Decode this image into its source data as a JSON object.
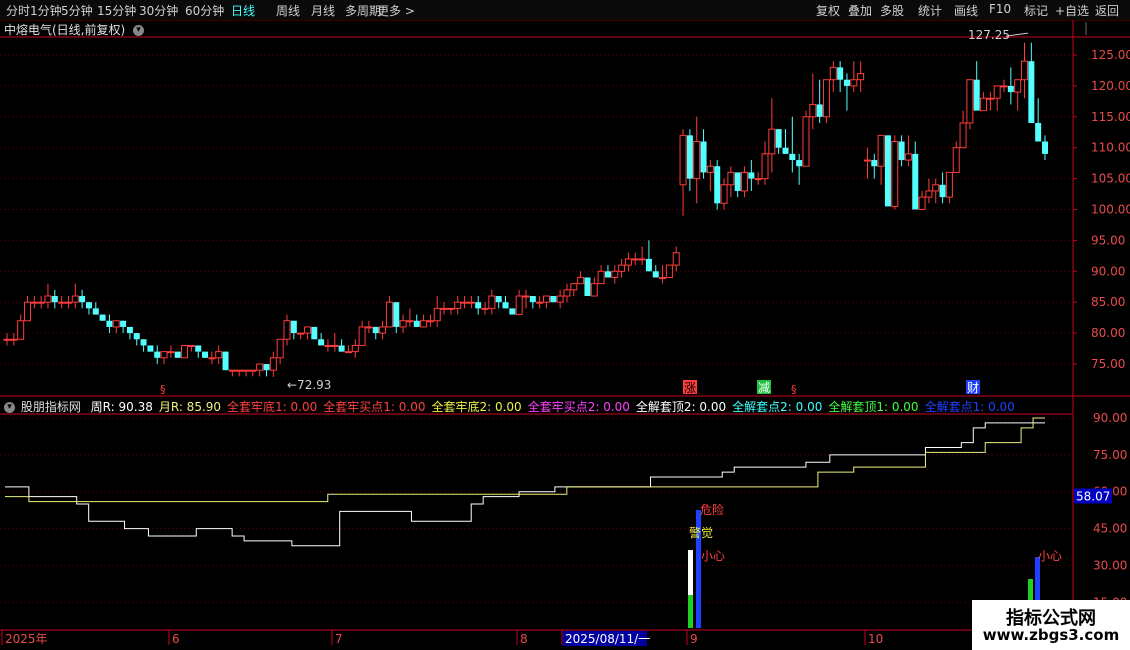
{
  "toolbar": {
    "periods": [
      "分时",
      "1分钟",
      "5分钟",
      "15分钟",
      "30分钟",
      "60分钟",
      "日线",
      "周线",
      "月线",
      "多周期",
      "更多 >"
    ],
    "active_period": "日线",
    "actions": [
      "复权",
      "叠加",
      "多股",
      "统计",
      "画线",
      "F10",
      "标记",
      "+自选",
      "返回"
    ]
  },
  "stock": {
    "title": "中熔电气(日线,前复权)"
  },
  "colors": {
    "up": "#ff3b3b",
    "down": "#54ffff",
    "grid": "#6b0000",
    "axis": "#c8001e",
    "text_axis": "#e84b4b",
    "yellow": "#f0f080",
    "white": "#ffffff"
  },
  "chart_data": {
    "type": "candlestick",
    "annotations": {
      "high_label": "127.25",
      "low_label": "72.93"
    },
    "price_ticks": [
      "125.00",
      "120.00",
      "115.00",
      "110.00",
      "105.00",
      "100.00",
      "95.00",
      "90.00",
      "85.00",
      "80.00",
      "75.00"
    ],
    "x_labels": [
      "2025年",
      "6",
      "7",
      "8",
      "2025/08/11/一",
      "9",
      "10"
    ],
    "candles": [
      [
        79,
        80,
        78,
        79
      ],
      [
        79,
        80,
        78,
        79
      ],
      [
        79,
        83,
        79,
        82
      ],
      [
        82,
        86,
        82,
        85
      ],
      [
        85,
        86,
        84,
        85
      ],
      [
        85,
        86,
        84,
        85
      ],
      [
        85,
        88,
        84,
        86
      ],
      [
        86,
        87,
        84,
        85
      ],
      [
        85,
        86,
        84,
        85
      ],
      [
        85,
        86,
        84,
        85
      ],
      [
        85,
        88,
        84,
        86
      ],
      [
        86,
        87,
        84,
        85
      ],
      [
        85,
        85,
        83,
        84
      ],
      [
        84,
        85,
        83,
        83
      ],
      [
        83,
        83,
        82,
        82
      ],
      [
        82,
        83,
        80,
        81
      ],
      [
        81,
        82,
        80,
        82
      ],
      [
        82,
        82,
        80,
        81
      ],
      [
        81,
        81,
        79,
        80
      ],
      [
        80,
        80,
        78,
        79
      ],
      [
        79,
        79,
        77,
        78
      ],
      [
        78,
        78,
        77,
        77
      ],
      [
        77,
        78,
        75,
        76
      ],
      [
        76,
        77,
        75,
        77
      ],
      [
        77,
        78,
        76,
        77
      ],
      [
        77,
        77,
        76,
        76
      ],
      [
        76,
        78,
        76,
        78
      ],
      [
        78,
        78,
        77,
        78
      ],
      [
        78,
        78,
        76,
        77
      ],
      [
        77,
        77,
        76,
        76
      ],
      [
        76,
        77,
        75,
        76
      ],
      [
        76,
        78,
        75,
        77
      ],
      [
        77,
        77,
        74,
        74
      ],
      [
        74,
        74,
        73,
        74
      ],
      [
        74,
        74,
        73,
        74
      ],
      [
        74,
        74,
        73,
        74
      ],
      [
        74,
        74,
        73,
        74
      ],
      [
        74,
        75,
        73,
        75
      ],
      [
        75,
        75,
        73,
        74
      ],
      [
        74,
        77,
        72.9,
        76
      ],
      [
        76,
        79,
        75,
        79
      ],
      [
        79,
        83,
        78,
        82
      ],
      [
        82,
        82,
        79,
        80
      ],
      [
        80,
        80,
        79,
        80
      ],
      [
        80,
        81,
        79,
        81
      ],
      [
        81,
        81,
        79,
        79
      ],
      [
        79,
        80,
        78,
        78
      ],
      [
        78,
        79,
        77,
        78
      ],
      [
        78,
        80,
        77,
        78
      ],
      [
        78,
        79,
        77,
        77
      ],
      [
        77,
        78,
        77,
        77
      ],
      [
        77,
        79,
        76,
        78
      ],
      [
        78,
        82,
        78,
        81
      ],
      [
        81,
        82,
        80,
        81
      ],
      [
        81,
        81,
        79,
        80
      ],
      [
        80,
        82,
        79,
        81
      ],
      [
        81,
        86,
        81,
        85
      ],
      [
        85,
        85,
        80,
        81
      ],
      [
        81,
        83,
        80,
        82
      ],
      [
        82,
        84,
        81,
        82
      ],
      [
        82,
        83,
        81,
        81
      ],
      [
        81,
        83,
        81,
        82
      ],
      [
        82,
        83,
        81,
        82
      ],
      [
        82,
        86,
        81,
        84
      ],
      [
        84,
        85,
        83,
        84
      ],
      [
        84,
        84,
        83,
        84
      ],
      [
        84,
        86,
        83,
        85
      ],
      [
        85,
        86,
        84,
        85
      ],
      [
        85,
        86,
        84,
        85
      ],
      [
        85,
        86,
        83,
        84
      ],
      [
        84,
        85,
        83,
        84
      ],
      [
        84,
        87,
        83,
        86
      ],
      [
        86,
        86,
        84,
        85
      ],
      [
        85,
        86,
        84,
        84
      ],
      [
        84,
        84,
        83,
        83
      ],
      [
        83,
        87,
        83,
        86
      ],
      [
        86,
        87,
        84,
        86
      ],
      [
        86,
        86,
        84,
        85
      ],
      [
        85,
        86,
        84,
        85
      ],
      [
        85,
        86,
        84,
        86
      ],
      [
        86,
        86,
        85,
        85
      ],
      [
        85,
        87,
        84,
        86
      ],
      [
        86,
        88,
        85,
        87
      ],
      [
        87,
        88,
        86,
        88
      ],
      [
        88,
        90,
        88,
        89
      ],
      [
        89,
        89,
        86,
        86
      ],
      [
        86,
        89,
        86,
        88
      ],
      [
        88,
        91,
        88,
        90
      ],
      [
        90,
        91,
        89,
        89
      ],
      [
        89,
        91,
        88,
        90
      ],
      [
        90,
        92,
        89,
        91
      ],
      [
        91,
        93,
        90,
        92
      ],
      [
        92,
        93,
        91,
        92
      ],
      [
        92,
        94,
        91,
        92
      ],
      [
        92,
        95,
        90,
        90
      ],
      [
        90,
        91,
        89,
        89
      ],
      [
        89,
        91,
        88,
        89
      ],
      [
        89,
        91,
        89,
        91
      ],
      [
        91,
        94,
        90,
        93
      ],
      [
        104,
        113,
        99,
        112
      ],
      [
        112,
        113,
        103,
        105
      ],
      [
        105,
        115,
        101,
        111
      ],
      [
        111,
        113,
        105,
        106
      ],
      [
        106,
        108,
        103,
        107
      ],
      [
        107,
        108,
        100,
        101
      ],
      [
        101,
        105,
        100,
        104
      ],
      [
        104,
        107,
        102,
        106
      ],
      [
        106,
        106,
        102,
        103
      ],
      [
        103,
        107,
        102,
        106
      ],
      [
        106,
        108,
        103,
        105
      ],
      [
        105,
        106,
        104,
        105
      ],
      [
        105,
        111,
        104,
        109
      ],
      [
        109,
        118,
        106,
        113
      ],
      [
        113,
        113,
        109,
        110
      ],
      [
        110,
        113,
        109,
        109
      ],
      [
        109,
        115,
        106,
        108
      ],
      [
        108,
        109,
        104,
        107
      ],
      [
        107,
        116,
        107,
        115
      ],
      [
        115,
        122,
        113,
        117
      ],
      [
        117,
        121,
        114,
        115
      ],
      [
        115,
        121,
        114,
        121
      ],
      [
        121,
        124,
        119,
        123
      ],
      [
        123,
        124,
        119,
        121
      ],
      [
        121,
        122,
        116,
        120
      ],
      [
        120,
        124,
        119,
        121
      ],
      [
        121,
        124,
        119,
        122
      ],
      [
        108,
        110,
        105,
        108
      ],
      [
        108,
        109,
        105,
        107
      ],
      [
        107,
        112,
        104,
        112
      ],
      [
        112,
        112,
        101,
        100.5
      ],
      [
        100.5,
        112,
        100,
        111
      ],
      [
        111,
        112,
        107,
        108
      ],
      [
        108,
        112,
        107,
        109
      ],
      [
        109,
        111,
        101,
        100
      ],
      [
        100,
        103,
        100,
        102
      ],
      [
        102,
        105,
        101,
        103
      ],
      [
        103,
        105,
        101,
        104
      ],
      [
        104,
        106,
        101,
        102
      ],
      [
        102,
        106,
        101,
        106
      ],
      [
        106,
        111,
        106,
        110
      ],
      [
        110,
        116,
        110,
        114
      ],
      [
        114,
        120,
        113,
        121
      ],
      [
        121,
        124,
        119,
        116
      ],
      [
        116,
        119,
        116,
        118
      ],
      [
        118,
        119,
        116,
        118
      ],
      [
        118,
        120,
        116,
        120
      ],
      [
        120,
        121,
        119,
        120
      ],
      [
        120,
        123,
        117,
        119
      ],
      [
        119,
        121,
        116,
        121
      ],
      [
        121,
        127,
        118,
        124
      ],
      [
        124,
        127,
        115,
        114
      ],
      [
        114,
        118,
        112,
        111
      ],
      [
        111,
        112,
        108,
        109
      ]
    ],
    "event_markers": [
      "涨",
      "减",
      "财"
    ],
    "indicator": {
      "name": "股朋指标网",
      "legend": [
        {
          "label": "周R: 90.38",
          "color": "#ffffff"
        },
        {
          "label": "月R: 85.90",
          "color": "#f0f080"
        },
        {
          "label": "全套牢底1: 0.00",
          "color": "#ff4040"
        },
        {
          "label": "全套牢买点1: 0.00",
          "color": "#ff4040"
        },
        {
          "label": "全套牢底2: 0.00",
          "color": "#f0f040"
        },
        {
          "label": "全套牢买点2: 0.00",
          "color": "#ff40ff"
        },
        {
          "label": "全解套顶2: 0.00",
          "color": "#ffffff"
        },
        {
          "label": "全解套点2: 0.00",
          "color": "#40ffff"
        },
        {
          "label": "全解套顶1: 0.00",
          "color": "#40ff40"
        },
        {
          "label": "全解套点1: 0.00",
          "color": "#2040ff"
        }
      ],
      "ticks": [
        "90.00",
        "75.00",
        "60.00",
        "45.00",
        "30.00",
        "15.00"
      ],
      "current_value": "58.07",
      "signals": [
        {
          "label": "危险",
          "color": "#ff4040"
        },
        {
          "label": "警觉",
          "color": "#f0f040"
        },
        {
          "label": "小心",
          "color": "#ff4040"
        },
        {
          "label": "小心",
          "color": "#ff4040"
        }
      ],
      "white_line": [
        62,
        62,
        58,
        58,
        58,
        58,
        55,
        48,
        48,
        48,
        45,
        45,
        42,
        42,
        42,
        42,
        45,
        45,
        45,
        42,
        40,
        40,
        40,
        40,
        38,
        38,
        38,
        38,
        52,
        52,
        52,
        52,
        52,
        52,
        48,
        48,
        48,
        48,
        48,
        55,
        58,
        58,
        58,
        60,
        60,
        60,
        62,
        62,
        62,
        62,
        62,
        62,
        62,
        62,
        66,
        66,
        66,
        66,
        66,
        66,
        68,
        70,
        70,
        70,
        70,
        70,
        70,
        72,
        72,
        75,
        75,
        75,
        75,
        75,
        75,
        75,
        75,
        78,
        78,
        78,
        80,
        86,
        88,
        88,
        88,
        88,
        88,
        88
      ],
      "yellow_line": [
        58,
        58,
        56,
        56,
        56,
        56,
        56,
        56,
        56,
        56,
        56,
        56,
        56,
        56,
        56,
        56,
        56,
        56,
        56,
        56,
        56,
        56,
        56,
        56,
        56,
        56,
        56,
        59,
        59,
        59,
        59,
        59,
        59,
        59,
        59,
        59,
        59,
        59,
        59,
        59,
        59,
        59,
        59,
        59,
        59,
        59,
        59,
        62,
        62,
        62,
        62,
        62,
        62,
        62,
        62,
        62,
        62,
        62,
        62,
        62,
        62,
        62,
        62,
        62,
        62,
        62,
        62,
        62,
        68,
        68,
        68,
        70,
        70,
        70,
        70,
        70,
        70,
        76,
        76,
        76,
        76,
        76,
        80,
        80,
        80,
        86,
        90,
        90
      ]
    }
  },
  "watermark": {
    "title": "指标公式网",
    "url": "www.zbgs3.com"
  }
}
